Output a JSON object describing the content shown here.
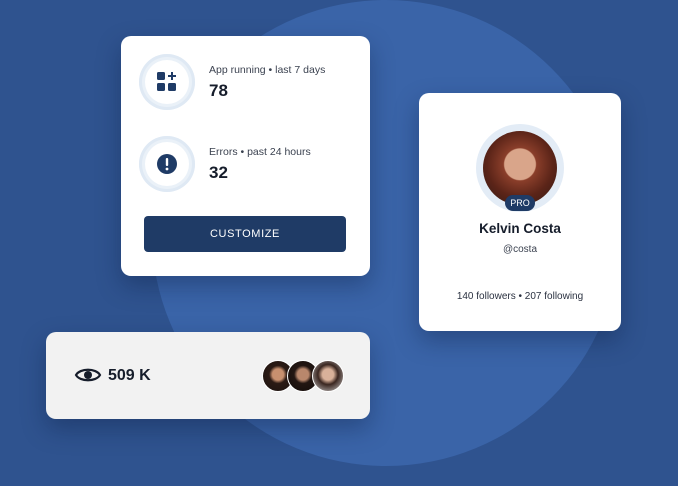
{
  "stats": {
    "app_running_label": "App running • last 7 days",
    "app_running_value": "78",
    "errors_label": "Errors • past 24 hours",
    "errors_value": "32",
    "customize_label": "CUSTOMIZE"
  },
  "profile": {
    "badge": "PRO",
    "name": "Kelvin Costa",
    "handle": "@costa",
    "follow_stats": "140 followers  • 207 following"
  },
  "views": {
    "count": "509 K",
    "viewer_avatars": [
      "avatar-1",
      "avatar-2",
      "avatar-3"
    ]
  },
  "colors": {
    "background": "#2f538f",
    "accent": "#1f3b66",
    "card": "#ffffff"
  },
  "icons": {
    "apps": "grid-plus-icon",
    "errors": "alert-icon",
    "views": "eye-icon"
  }
}
